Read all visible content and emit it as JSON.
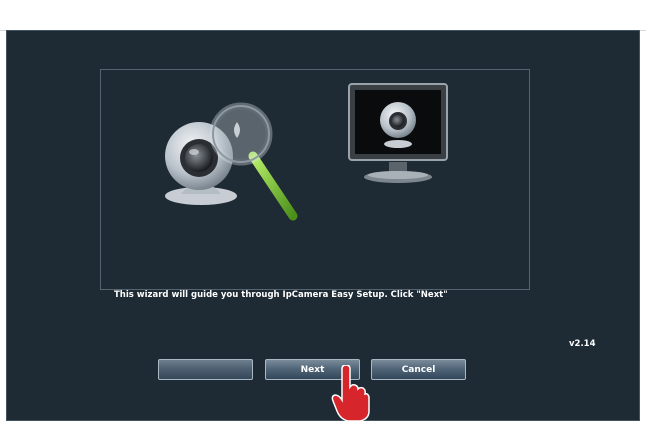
{
  "wizard": {
    "message": "This wizard will guide you through IpCamera Easy Setup. Click \"Next\"",
    "version": "v2.14"
  },
  "buttons": {
    "back_label": "",
    "next_label": "Next",
    "cancel_label": "Cancel"
  },
  "icons": {
    "illustration_left": "camera-magnifier-icon",
    "illustration_right": "monitor-camera-icon",
    "pointer": "hand-pointer-icon"
  },
  "colors": {
    "window_background": "#1e2a34",
    "button_top": "#7a8c9a",
    "button_bottom": "#32465a",
    "magnifier_handle": "#6dbb2a",
    "cursor_red": "#d7262b"
  }
}
